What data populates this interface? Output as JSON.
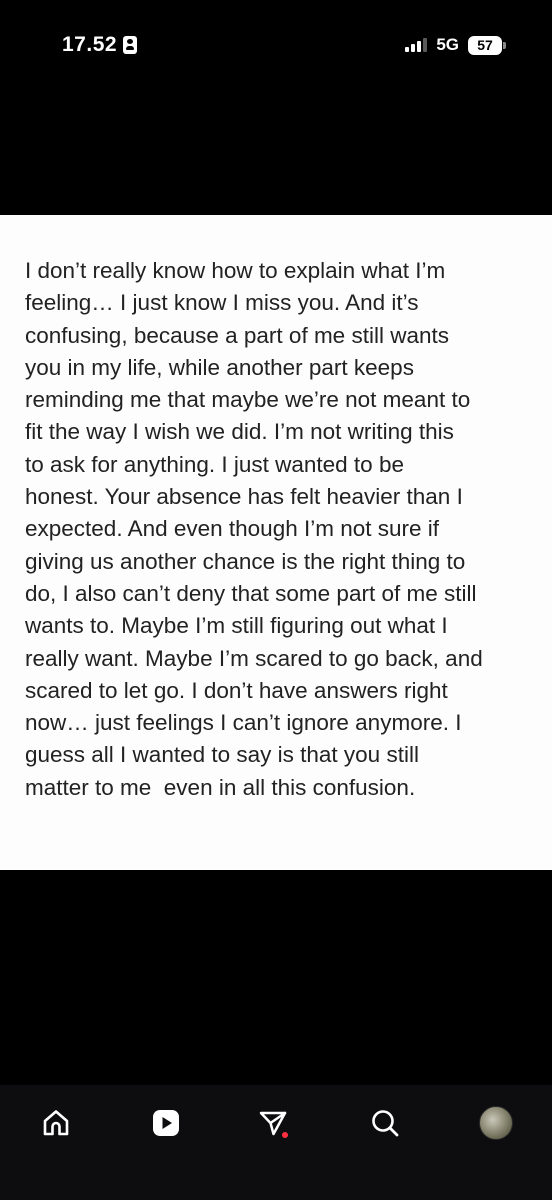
{
  "status_bar": {
    "time": "17.52",
    "network": "5G",
    "battery": "57"
  },
  "note": {
    "lines": [
      "I don’t really know how to explain what I’m",
      "feeling… I just know I miss you. And it’s",
      "confusing, because a part of me still wants",
      "you in my life, while another part keeps",
      "reminding me that maybe we’re not meant to",
      "fit the way I wish we did. I’m not writing this",
      "to ask for anything. I just wanted to be",
      "honest. Your absence has felt heavier than I",
      "expected. And even though I’m not sure if",
      "giving us another chance is the right thing to",
      "do, I also can’t deny that some part of me still",
      "wants to. Maybe I’m still figuring out what I",
      "really want. Maybe I’m scared to go back, and",
      "scared to let go. I don’t have answers right",
      "now… just feelings I can’t ignore anymore. I",
      "guess all I wanted to say is that you still",
      "matter to me  even in all this confusion."
    ]
  },
  "tab_bar": {
    "tabs": [
      {
        "name": "home",
        "icon": "home-icon"
      },
      {
        "name": "reels",
        "icon": "play-icon"
      },
      {
        "name": "messages",
        "icon": "send-icon"
      },
      {
        "name": "search",
        "icon": "search-icon"
      },
      {
        "name": "profile",
        "icon": "avatar"
      }
    ],
    "notification_color": "#ff3040"
  }
}
